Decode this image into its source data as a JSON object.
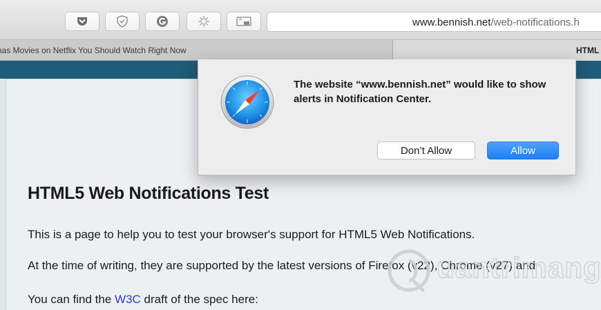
{
  "toolbar": {
    "buttons": [
      {
        "name": "pocket-icon"
      },
      {
        "name": "shield-icon"
      },
      {
        "name": "grammarly-icon"
      },
      {
        "name": "puzzle-extension-icon"
      },
      {
        "name": "picture-in-picture-icon"
      }
    ],
    "url_host": "www.bennish.net",
    "url_path": "/web-notifications.h"
  },
  "tabs": [
    {
      "title": "nas Movies on Netflix You Should Watch Right Now"
    },
    {
      "title": "HTML"
    }
  ],
  "dialog": {
    "message": "The website “www.bennish.net” would like to show alerts in Notification Center.",
    "deny_label": "Don’t Allow",
    "allow_label": "Allow",
    "icon": "safari-compass-icon"
  },
  "page": {
    "title": "HTML5 Web Notifications Test",
    "p1": "This is a page to help you to test your browser's support for HTML5 Web Notifications.",
    "p2": "At the time of writing, they are supported by the latest versions of Firefox (v22), Chrome (v27) and",
    "p3_before": "You can find the ",
    "p3_link": "W3C",
    "p3_after": " draft of the spec here:"
  },
  "watermark": {
    "text": "uantrimang"
  },
  "colors": {
    "page_header": "#1f5c77",
    "allow_button": "#1d7ef6",
    "link": "#2a3fcf"
  }
}
